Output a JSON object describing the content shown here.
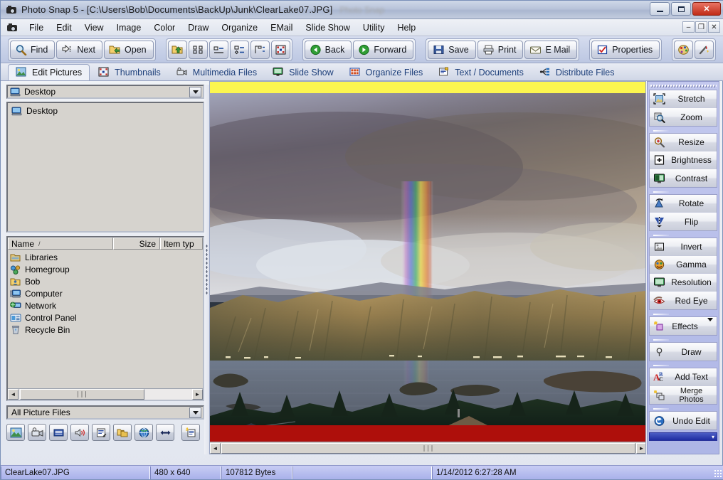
{
  "window": {
    "title": "Photo Snap 5 - [C:\\Users\\Bob\\Documents\\BackUp\\Junk\\ClearLake07.JPG]",
    "ghost_title": "Photo Snap",
    "minimize": "–",
    "maximize": "❐",
    "close": "✕"
  },
  "menu": {
    "items": [
      {
        "label": "File"
      },
      {
        "label": "Edit"
      },
      {
        "label": "View"
      },
      {
        "label": "Image"
      },
      {
        "label": "Color"
      },
      {
        "label": "Draw"
      },
      {
        "label": "Organize"
      },
      {
        "label": "EMail"
      },
      {
        "label": "Slide Show"
      },
      {
        "label": "Utility"
      },
      {
        "label": "Help"
      }
    ],
    "mdi": {
      "minimize": "–",
      "restore": "❐",
      "close": "✕"
    }
  },
  "toolbar": {
    "find": "Find",
    "next": "Next",
    "open": "Open",
    "back": "Back",
    "forward": "Forward",
    "save": "Save",
    "print": "Print",
    "email": "E Mail",
    "properties": "Properties",
    "help": "?"
  },
  "tabs": [
    {
      "label": "Edit Pictures",
      "active": true
    },
    {
      "label": "Thumbnails",
      "active": false
    },
    {
      "label": "Multimedia Files",
      "active": false
    },
    {
      "label": "Slide Show",
      "active": false
    },
    {
      "label": "Organize Files",
      "active": false
    },
    {
      "label": "Text / Documents",
      "active": false
    },
    {
      "label": "Distribute Files",
      "active": false
    }
  ],
  "left_panel": {
    "folder_combo_value": "Desktop",
    "tree_items": [
      {
        "label": "Desktop"
      }
    ],
    "list_headers": [
      "Name",
      "Size",
      "Item typ"
    ],
    "list_items": [
      {
        "name": "Libraries"
      },
      {
        "name": "Homegroup"
      },
      {
        "name": "Bob"
      },
      {
        "name": "Computer"
      },
      {
        "name": "Network"
      },
      {
        "name": "Control Panel"
      },
      {
        "name": "Recycle Bin"
      }
    ],
    "filter_combo_value": "All Picture Files",
    "scroll_grip": "∣∣∣",
    "scroll_left": "◄",
    "scroll_right": "►"
  },
  "viewer": {
    "scroll_grip": "∣∣∣",
    "scroll_left": "◄",
    "scroll_right": "►",
    "top_band_color": "#fcf64f",
    "bottom_band_color": "#ae0f0b"
  },
  "right_panel": {
    "groups": [
      {
        "buttons": [
          {
            "label": "Stretch",
            "icon": "stretch-icon"
          },
          {
            "label": "Zoom",
            "icon": "zoom-icon"
          }
        ]
      },
      {
        "buttons": [
          {
            "label": "Resize",
            "icon": "resize-icon"
          },
          {
            "label": "Brightness",
            "icon": "brightness-icon"
          },
          {
            "label": "Contrast",
            "icon": "contrast-icon"
          }
        ]
      },
      {
        "buttons": [
          {
            "label": "Rotate",
            "icon": "rotate-icon"
          },
          {
            "label": "Flip",
            "icon": "flip-icon"
          }
        ]
      },
      {
        "buttons": [
          {
            "label": "Invert",
            "icon": "invert-icon"
          },
          {
            "label": "Gamma",
            "icon": "gamma-icon"
          },
          {
            "label": "Resolution",
            "icon": "resolution-icon"
          },
          {
            "label": "Red Eye",
            "icon": "red-eye-icon"
          }
        ]
      },
      {
        "buttons": [
          {
            "label": "Effects",
            "icon": "effects-icon",
            "dropdown": true
          }
        ]
      },
      {
        "buttons": [
          {
            "label": "Draw",
            "icon": "draw-icon"
          }
        ]
      },
      {
        "buttons": [
          {
            "label": "Add Text",
            "icon": "add-text-icon"
          },
          {
            "label": "Merge Photos",
            "icon": "merge-photos-icon"
          }
        ]
      },
      {
        "buttons": [
          {
            "label": "Undo Edit",
            "icon": "undo-icon"
          }
        ]
      }
    ]
  },
  "status_bar": {
    "filename": "ClearLake07.JPG",
    "dimensions": "480 x 640",
    "filesize": "107812 Bytes",
    "extra": "",
    "timestamp": "1/14/2012 6:27:28 AM"
  }
}
